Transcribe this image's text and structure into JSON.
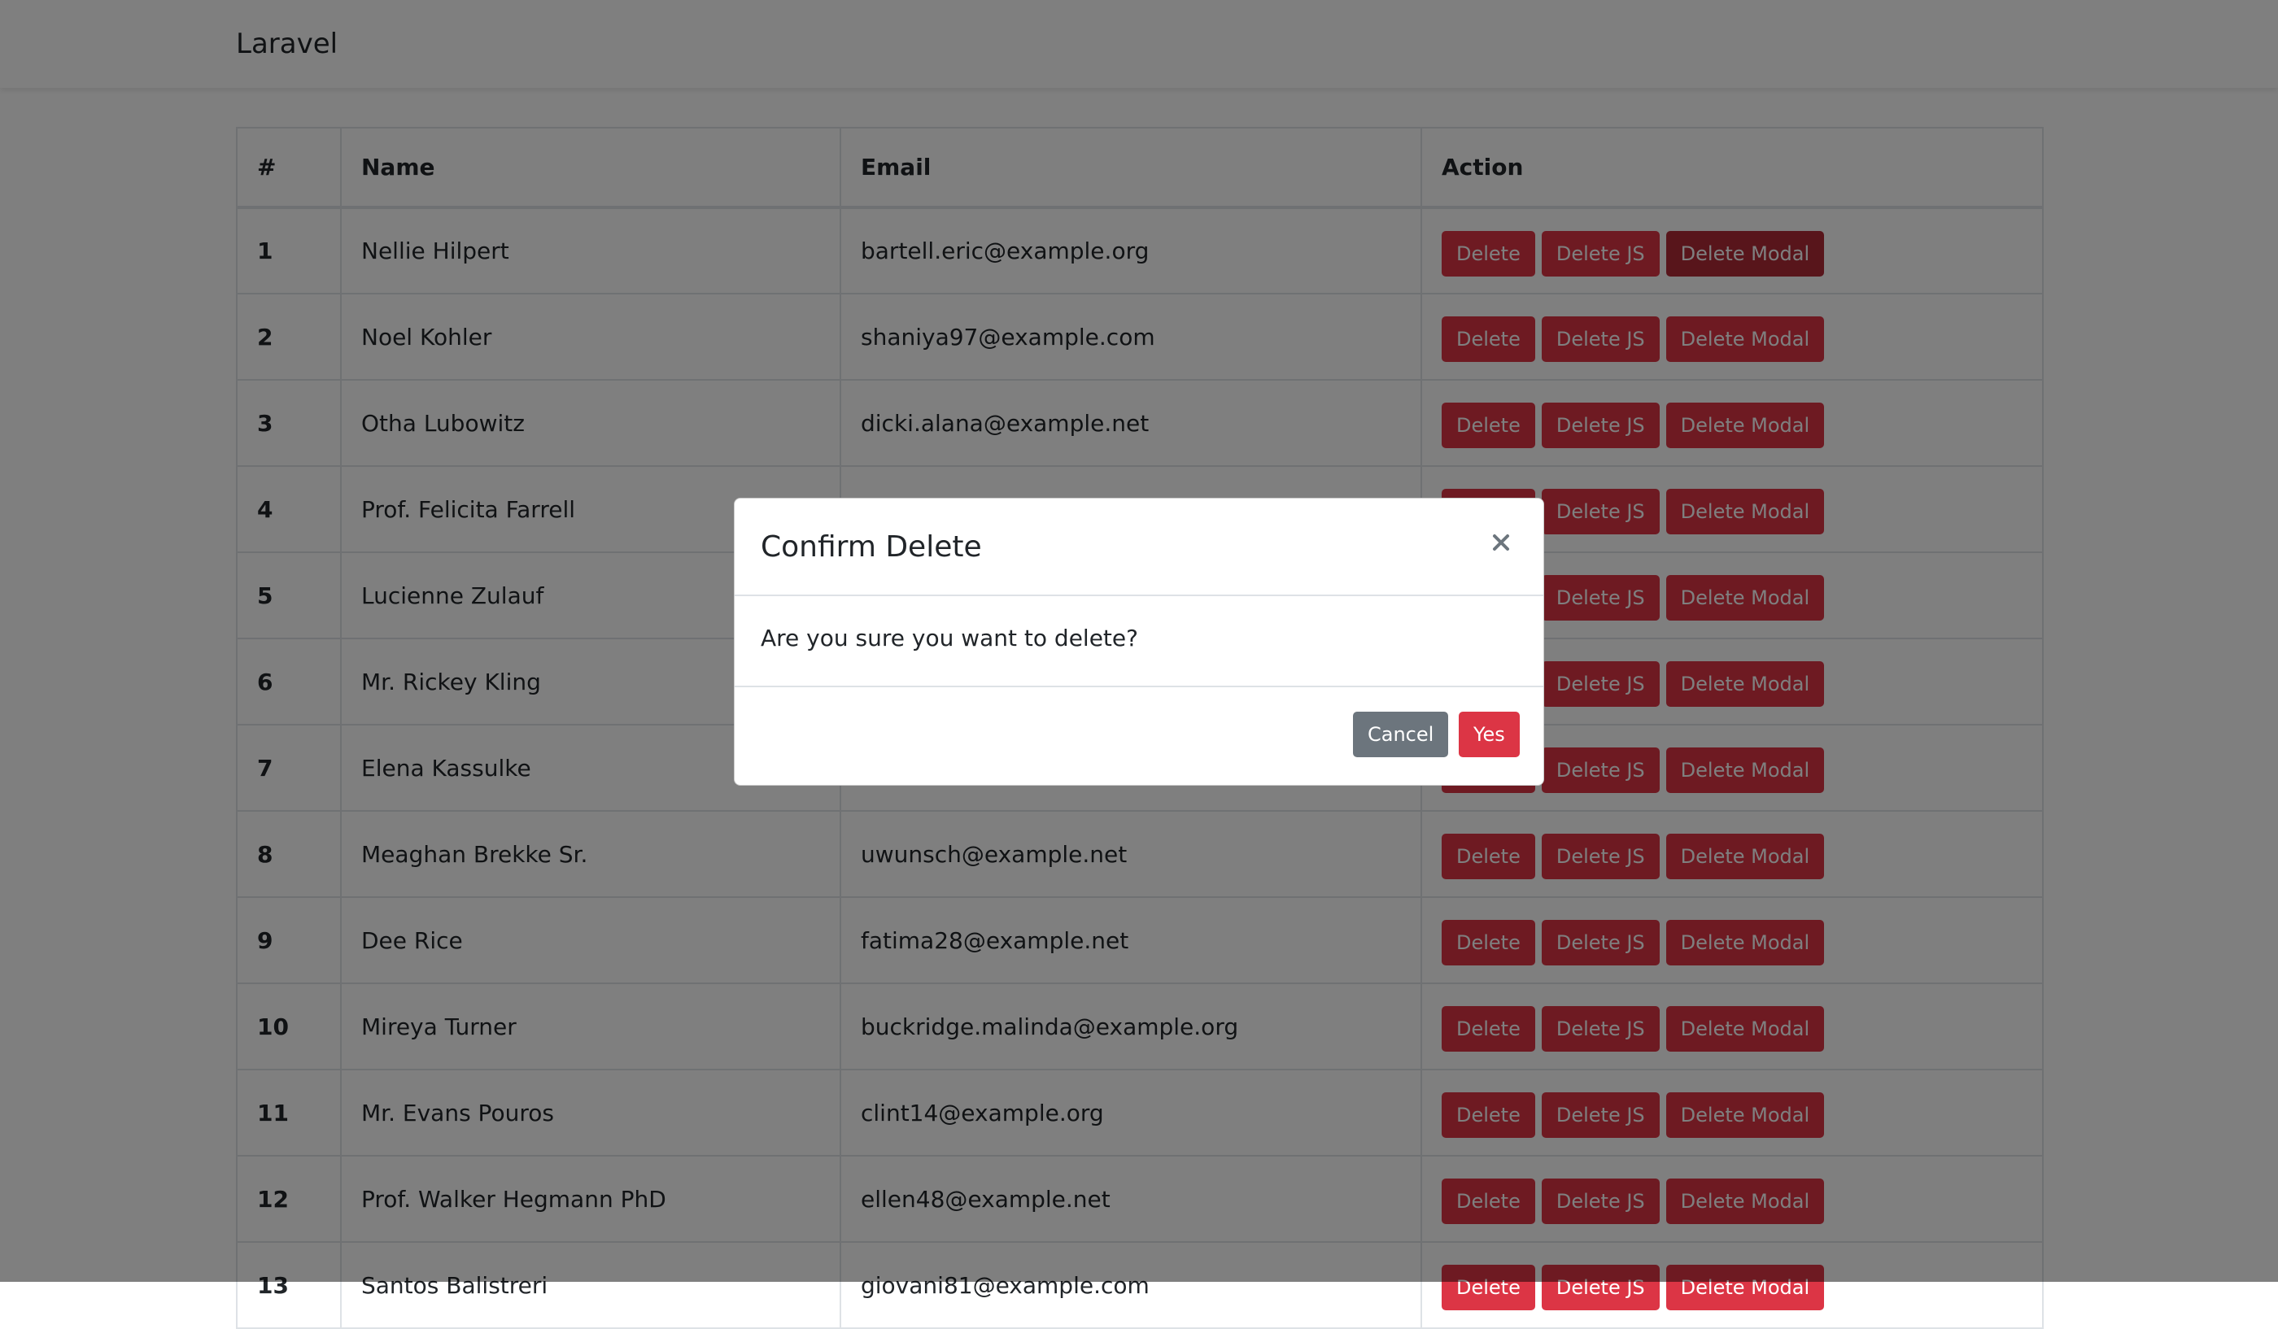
{
  "navbar": {
    "brand": "Laravel"
  },
  "table": {
    "headers": [
      "#",
      "Name",
      "Email",
      "Action"
    ],
    "rows": [
      {
        "id": "1",
        "name": "Nellie Hilpert",
        "email": "bartell.eric@example.org"
      },
      {
        "id": "2",
        "name": "Noel Kohler",
        "email": "shaniya97@example.com"
      },
      {
        "id": "3",
        "name": "Otha Lubowitz",
        "email": "dicki.alana@example.net"
      },
      {
        "id": "4",
        "name": "Prof. Felicita Farrell",
        "email": ""
      },
      {
        "id": "5",
        "name": "Lucienne Zulauf",
        "email": ""
      },
      {
        "id": "6",
        "name": "Mr. Rickey Kling",
        "email": ""
      },
      {
        "id": "7",
        "name": "Elena Kassulke",
        "email": ""
      },
      {
        "id": "8",
        "name": "Meaghan Brekke Sr.",
        "email": "uwunsch@example.net"
      },
      {
        "id": "9",
        "name": "Dee Rice",
        "email": "fatima28@example.net"
      },
      {
        "id": "10",
        "name": "Mireya Turner",
        "email": "buckridge.malinda@example.org"
      },
      {
        "id": "11",
        "name": "Mr. Evans Pouros",
        "email": "clint14@example.org"
      },
      {
        "id": "12",
        "name": "Prof. Walker Hegmann PhD",
        "email": "ellen48@example.net"
      },
      {
        "id": "13",
        "name": "Santos Balistreri",
        "email": "giovani81@example.com"
      }
    ],
    "actions": {
      "delete_label": "Delete",
      "delete_js_label": "Delete JS",
      "delete_modal_label": "Delete Modal"
    }
  },
  "modal": {
    "title": "Confirm Delete",
    "close_icon": "close-icon",
    "body": "Are you sure you want to delete?",
    "cancel_label": "Cancel",
    "yes_label": "Yes"
  },
  "colors": {
    "danger": "#dc3545",
    "danger_dark": "#b02a37",
    "secondary": "#6c757d",
    "backdrop": "rgba(0,0,0,0.5)"
  }
}
